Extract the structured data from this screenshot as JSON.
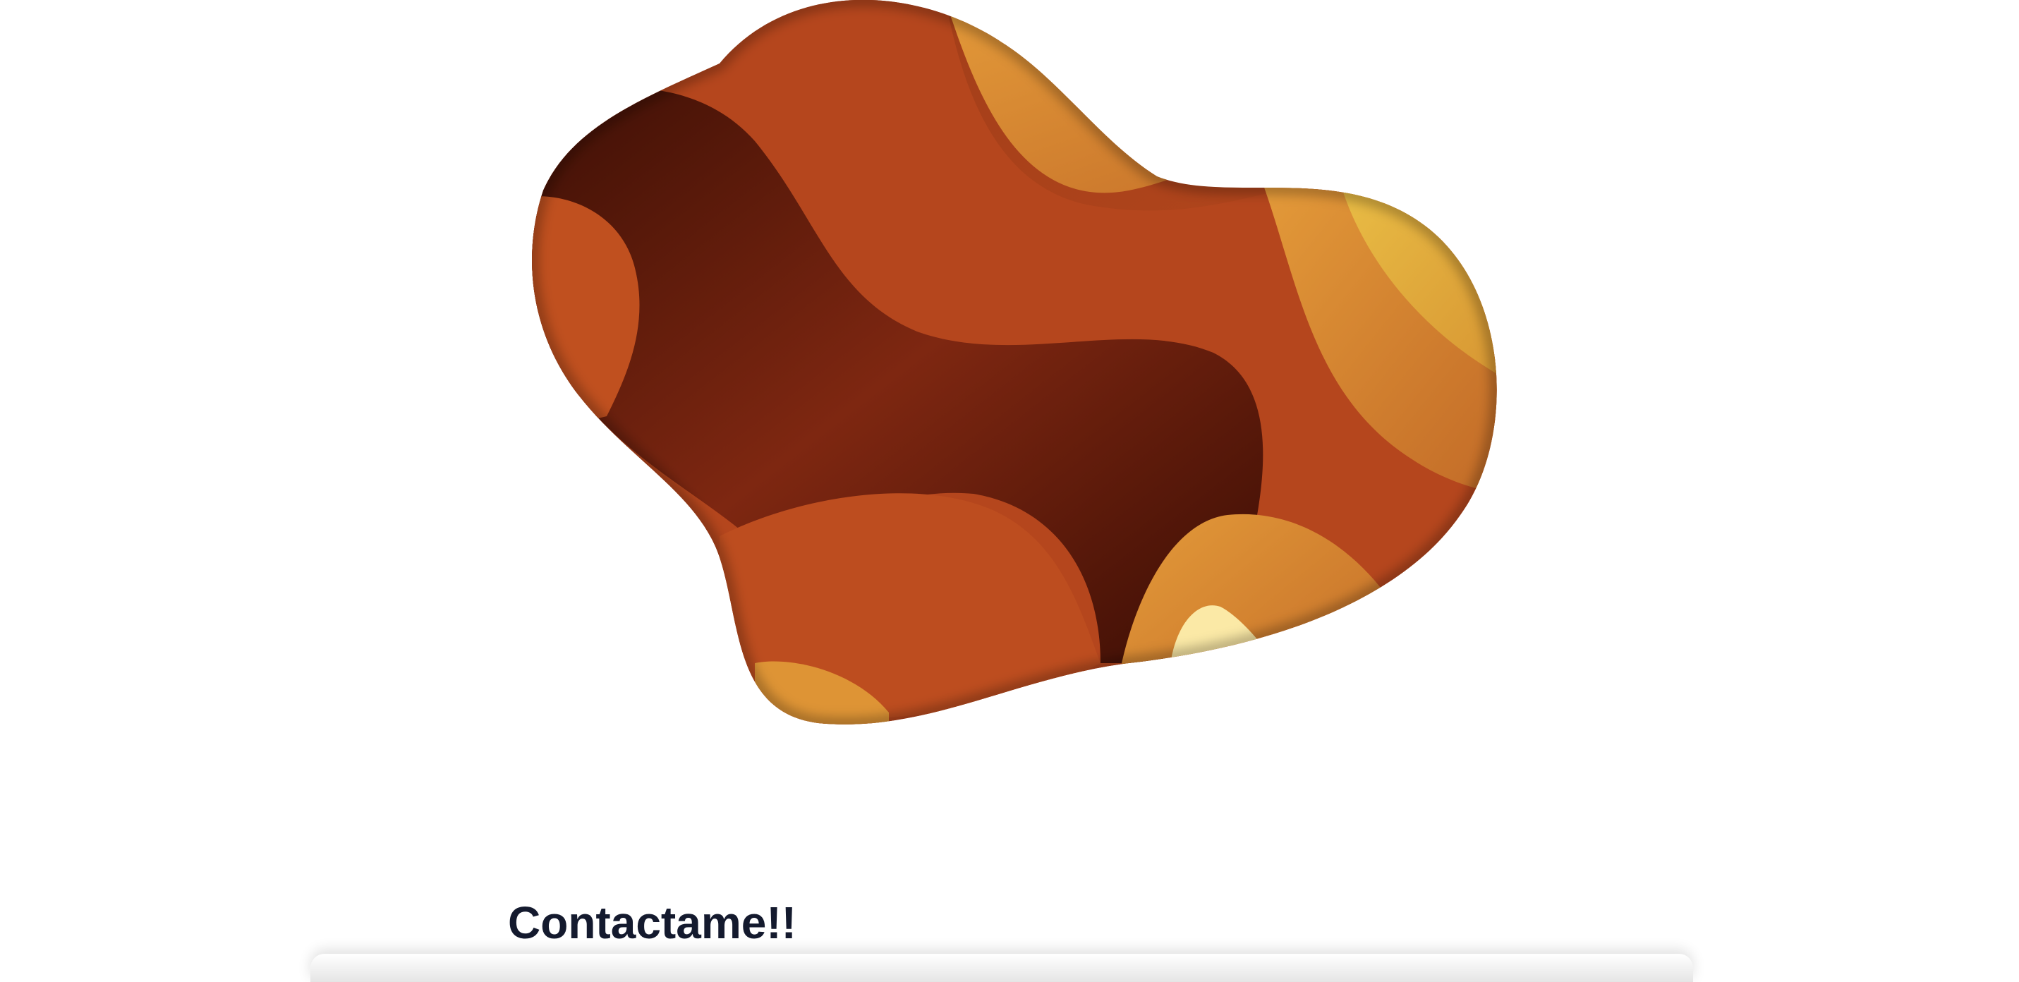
{
  "contact": {
    "heading": "Contactame!!"
  },
  "hero_image": {
    "icon": "abstract-blob-illustration",
    "colors": {
      "dark": "#4a1407",
      "rust": "#b9451e",
      "brown": "#7a2510",
      "orange": "#df9236",
      "gold": "#e6b640",
      "cream": "#fbe9a6"
    }
  }
}
